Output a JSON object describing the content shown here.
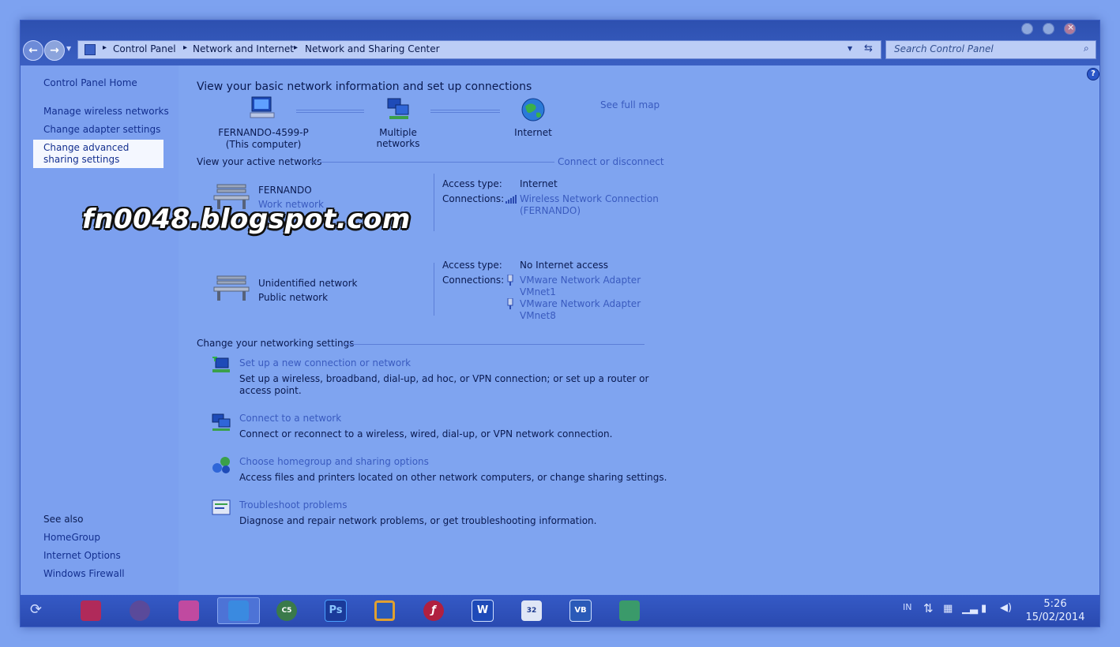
{
  "breadcrumb": [
    "Control Panel",
    "Network and Internet",
    "Network and Sharing Center"
  ],
  "search": {
    "placeholder": "Search Control Panel"
  },
  "sidebar": {
    "home": "Control Panel Home",
    "items": [
      "Manage wireless networks",
      "Change adapter settings",
      "Change advanced sharing settings"
    ],
    "see_also_title": "See also",
    "see_also": [
      "HomeGroup",
      "Internet Options",
      "Windows Firewall"
    ]
  },
  "main": {
    "heading": "View your basic network information and set up connections",
    "see_full_map": "See full map",
    "map": {
      "computer_name": "FERNANDO-4599-P",
      "computer_sub": "(This computer)",
      "middle": "Multiple networks",
      "internet": "Internet"
    },
    "active_title": "View your active networks",
    "connect_disconnect": "Connect or disconnect",
    "networks": [
      {
        "name": "FERNANDO",
        "type": "Work network",
        "access_label": "Access type:",
        "access_value": "Internet",
        "connections_label": "Connections:",
        "connections": [
          "Wireless Network Connection",
          "(FERNANDO)"
        ]
      },
      {
        "name": "Unidentified network",
        "type": "Public network",
        "access_label": "Access type:",
        "access_value": "No Internet access",
        "connections_label": "Connections:",
        "connections": [
          "VMware Network Adapter",
          "VMnet1",
          "VMware Network Adapter",
          "VMnet8"
        ]
      }
    ],
    "settings_title": "Change your networking settings",
    "settings": [
      {
        "title": "Set up a new connection or network",
        "desc": "Set up a wireless, broadband, dial-up, ad hoc, or VPN connection; or set up a router or access point."
      },
      {
        "title": "Connect to a network",
        "desc": "Connect or reconnect to a wireless, wired, dial-up, or VPN network connection."
      },
      {
        "title": "Choose homegroup and sharing options",
        "desc": "Access files and printers located on other network computers, or change sharing settings."
      },
      {
        "title": "Troubleshoot problems",
        "desc": "Diagnose and repair network problems, or get troubleshooting information."
      }
    ]
  },
  "watermark": "fn0048.blogspot.com",
  "taskbar": {
    "apps": [
      "calendar-icon",
      "browser-globe-icon",
      "books-icon",
      "network-center-icon",
      "cs5-icon",
      "photoshop-icon",
      "vmware-icon",
      "flash-icon",
      "word-icon",
      "app32-icon",
      "virtualbox-icon",
      "network-tool-icon"
    ],
    "labels": {
      "ps": "Ps",
      "word": "W",
      "vb": "VB",
      "cs5": "C5",
      "app32": "32"
    },
    "lang": "IN",
    "time": "5:26",
    "date": "15/02/2014"
  },
  "colors": {
    "background": "#7fa4f0",
    "titlebar": "#2d50b0",
    "taskbar": "#2a4ab0",
    "link": "#3a5bbf"
  }
}
